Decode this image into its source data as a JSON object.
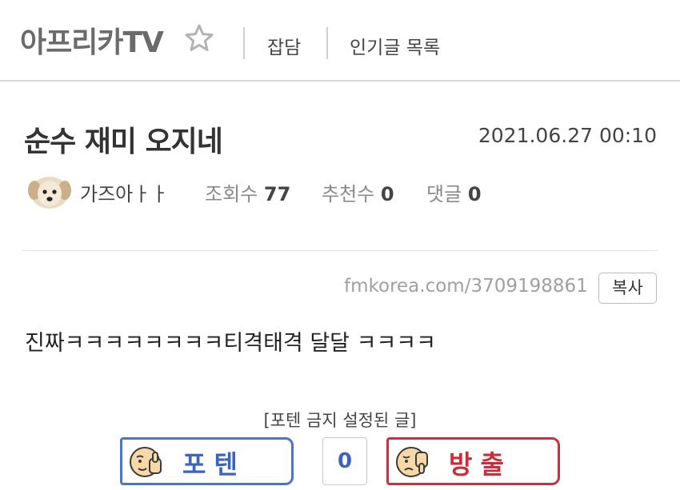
{
  "header": {
    "board_name": "아프리카TV",
    "nav": [
      "잡담",
      "인기글 목록"
    ]
  },
  "post": {
    "title": "순수 재미 오지네",
    "date": "2021.06.27 00:10",
    "author": "가즈아ㅏㅏ",
    "views_label": "조회수",
    "views": "77",
    "recommend_label": "추천수",
    "recommend": "0",
    "comments_label": "댓글",
    "comments": "0",
    "url": "fmkorea.com/3709198861",
    "copy_label": "복사",
    "body": "진짜ㅋㅋㅋㅋㅋㅋㅋㅋ티격태격 달달 ㅋㅋㅋㅋ"
  },
  "vote": {
    "notice": "[포텐 금지 설정된 글]",
    "up_label": "포텐",
    "count": "0",
    "down_label": "방출"
  },
  "colors": {
    "up": "#4a76c8",
    "down": "#c8323c"
  },
  "icons": [
    "star-icon",
    "avatar",
    "thumbs-up-face-icon",
    "thumbs-down-face-icon"
  ]
}
